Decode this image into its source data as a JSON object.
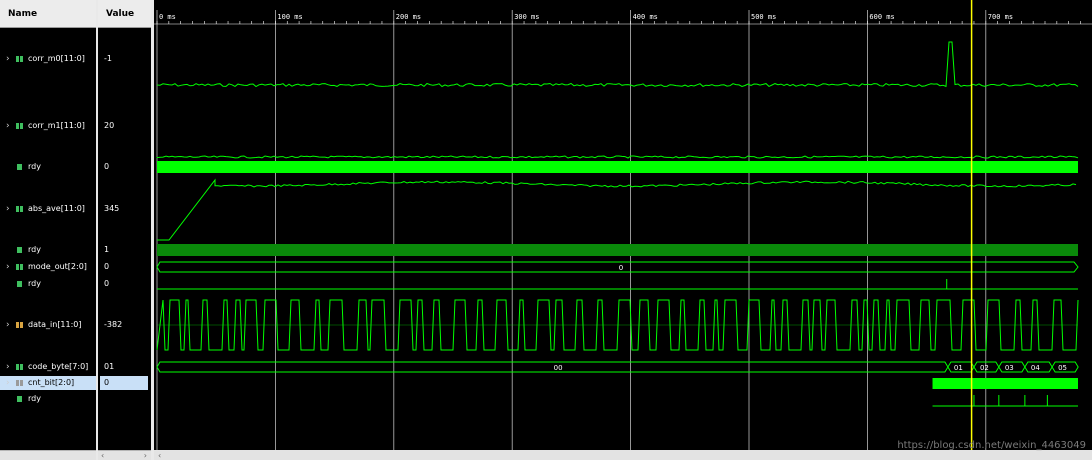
{
  "columns": {
    "name": "Name",
    "value": "Value"
  },
  "timeline": {
    "ticks": [
      "0 ms",
      "100 ms",
      "200 ms",
      "300 ms",
      "400 ms",
      "500 ms",
      "600 ms",
      "700 ms"
    ],
    "cursor_ms": 688
  },
  "signals": [
    {
      "name": "corr_m0[11:0]",
      "value": "-1",
      "expandable": true,
      "type": "bus"
    },
    {
      "name": "corr_m1[11:0]",
      "value": "20",
      "expandable": true,
      "type": "bus"
    },
    {
      "name": "rdy",
      "value": "0",
      "expandable": false,
      "type": "bit"
    },
    {
      "name": "abs_ave[11:0]",
      "value": "345",
      "expandable": true,
      "type": "bus"
    },
    {
      "name": "rdy",
      "value": "1",
      "expandable": false,
      "type": "bit"
    },
    {
      "name": "mode_out[2:0]",
      "value": "0",
      "expandable": true,
      "type": "bus"
    },
    {
      "name": "rdy",
      "value": "0",
      "expandable": false,
      "type": "bit"
    },
    {
      "name": "data_in[11:0]",
      "value": "-382",
      "expandable": true,
      "type": "bus"
    },
    {
      "name": "code_byte[7:0]",
      "value": "01",
      "expandable": true,
      "type": "bus"
    },
    {
      "name": "cnt_bit[2:0]",
      "value": "0",
      "expandable": true,
      "type": "bus",
      "selected": true
    },
    {
      "name": "rdy",
      "value": "",
      "expandable": false,
      "type": "bit"
    }
  ],
  "bus_labels": {
    "mode_out": "0",
    "code_byte_main": "00",
    "code_byte_values": [
      "01",
      "02",
      "03",
      "04",
      "05"
    ]
  },
  "watermark": "https://blog.csdn.net/weixin_4463049",
  "colors": {
    "wave": "#00ff00",
    "cursor": "#ffff00",
    "grid": "#c8c8c8"
  }
}
